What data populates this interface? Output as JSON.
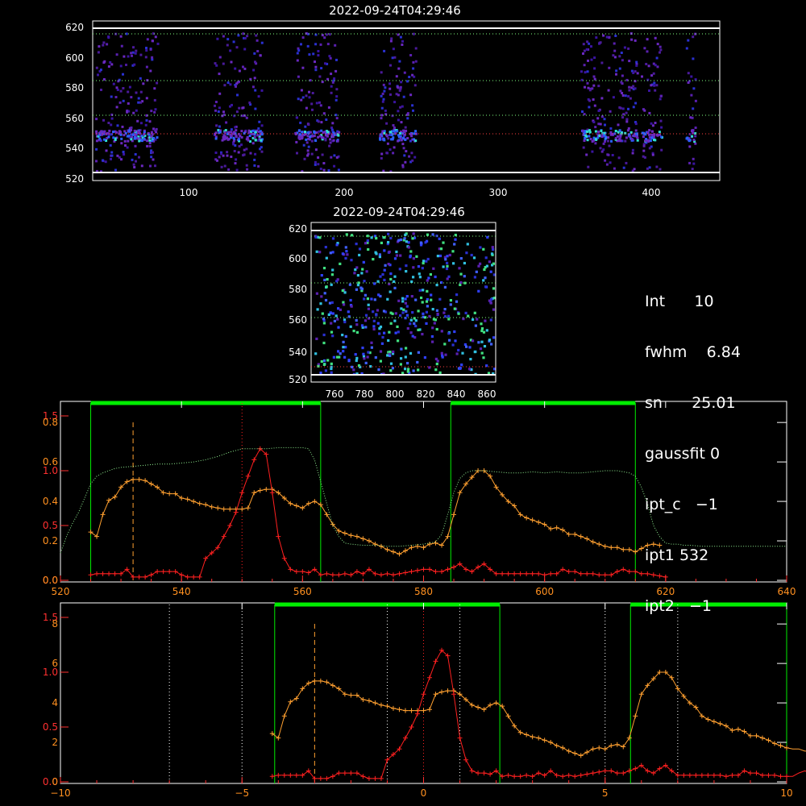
{
  "panels": {
    "top_image": {
      "title": "2022-09-24T04:29:46",
      "xticks": [
        "100",
        "200",
        "300",
        "400"
      ],
      "yticks": [
        "520",
        "540",
        "560",
        "580",
        "600",
        "620"
      ]
    },
    "zoom_image": {
      "title": "2022-09-24T04:29:46",
      "xticks": [
        "760",
        "780",
        "800",
        "820",
        "840",
        "860"
      ],
      "yticks": [
        "520",
        "540",
        "560",
        "580",
        "600",
        "620"
      ]
    }
  },
  "info": {
    "int_label": "Int",
    "int_value": "10",
    "fwhm_label": "fwhm",
    "fwhm_value": "6.84",
    "sn_label": "sn",
    "sn_value": "25.01",
    "gaussfit_label": "gaussfit",
    "gaussfit_value": "0",
    "ipt_c_label": "ipt_c",
    "ipt_c_value": "−1",
    "ipt1_label": "ipt1",
    "ipt1_value": "532",
    "ipt2_label": "ipt2",
    "ipt2_value": "−1"
  },
  "colors": {
    "background": "#000000",
    "axis": "#ffffff",
    "red_series": "#ff2020",
    "orange_series": "#ffa030",
    "green_band": "#00ee00",
    "green_dotted": "#90ee90",
    "red_axis": "#ff3030",
    "orange_axis": "#ff9020"
  },
  "chart_data": [
    {
      "type": "line",
      "x_range": [
        520,
        640
      ],
      "xticks": [
        "520",
        "540",
        "560",
        "580",
        "600",
        "620",
        "640"
      ],
      "y_left_red": [
        "0.0",
        "0.5",
        "1.0",
        "1.5"
      ],
      "y_left_orange": [
        "0.0",
        "0.2",
        "0.4",
        "0.6",
        "0.8"
      ],
      "green_bands": [
        [
          525,
          563
        ],
        [
          584.5,
          615
        ]
      ],
      "green_band_top": 1.5,
      "vlines": [
        {
          "x": 532,
          "style": "dashed",
          "color": "orange"
        },
        {
          "x": 550,
          "style": "dotted",
          "color": "red"
        }
      ],
      "series": [
        {
          "color": "orange",
          "x": [
            525,
            526,
            527,
            528,
            529,
            530,
            531,
            532,
            533,
            534,
            535,
            536,
            537,
            538,
            539,
            540,
            541,
            542,
            543,
            544,
            545,
            546,
            547,
            548,
            549,
            550,
            551,
            552,
            553,
            554,
            555,
            556,
            557,
            558,
            559,
            560,
            561,
            562,
            563,
            564,
            565,
            566,
            567,
            568,
            569,
            570,
            571,
            572,
            573,
            574,
            575,
            576,
            577,
            578,
            579,
            580,
            581,
            582,
            583,
            584,
            585,
            586,
            587,
            588,
            589,
            590,
            591,
            592,
            593,
            594,
            595,
            596,
            597,
            598,
            599,
            600,
            601,
            602,
            603,
            604,
            605,
            606,
            607,
            608,
            609,
            610,
            611,
            612,
            613,
            614,
            615,
            616,
            617,
            618,
            619
          ],
          "y": [
            0.44,
            0.4,
            0.6,
            0.73,
            0.76,
            0.85,
            0.9,
            0.92,
            0.92,
            0.91,
            0.88,
            0.85,
            0.8,
            0.79,
            0.79,
            0.75,
            0.74,
            0.72,
            0.7,
            0.69,
            0.67,
            0.66,
            0.65,
            0.65,
            0.65,
            0.65,
            0.66,
            0.8,
            0.82,
            0.83,
            0.83,
            0.8,
            0.75,
            0.7,
            0.68,
            0.66,
            0.7,
            0.72,
            0.69,
            0.6,
            0.51,
            0.45,
            0.43,
            0.41,
            0.4,
            0.38,
            0.36,
            0.33,
            0.31,
            0.28,
            0.26,
            0.24,
            0.27,
            0.3,
            0.31,
            0.3,
            0.33,
            0.34,
            0.32,
            0.4,
            0.6,
            0.8,
            0.88,
            0.94,
            1.0,
            1.0,
            0.95,
            0.85,
            0.78,
            0.72,
            0.68,
            0.6,
            0.57,
            0.55,
            0.53,
            0.51,
            0.47,
            0.48,
            0.46,
            0.42,
            0.42,
            0.4,
            0.38,
            0.35,
            0.33,
            0.31,
            0.3,
            0.3,
            0.28,
            0.28,
            0.26,
            0.29,
            0.32,
            0.33,
            0.32
          ]
        },
        {
          "color": "red",
          "x": [
            525,
            526,
            527,
            528,
            529,
            530,
            531,
            532,
            533,
            534,
            535,
            536,
            537,
            538,
            539,
            540,
            541,
            542,
            543,
            544,
            545,
            546,
            547,
            548,
            549,
            550,
            551,
            552,
            553,
            554,
            555,
            556,
            557,
            558,
            559,
            560,
            561,
            562,
            563,
            564,
            565,
            566,
            567,
            568,
            569,
            570,
            571,
            572,
            573,
            574,
            575,
            576,
            577,
            578,
            579,
            580,
            581,
            582,
            583,
            584,
            585,
            586,
            587,
            588,
            589,
            590,
            591,
            592,
            593,
            594,
            595,
            596,
            597,
            598,
            599,
            600,
            601,
            602,
            603,
            604,
            605,
            606,
            607,
            608,
            609,
            610,
            611,
            612,
            613,
            614,
            615,
            616,
            617,
            618,
            619,
            620
          ],
          "y": [
            0.05,
            0.06,
            0.06,
            0.06,
            0.06,
            0.06,
            0.1,
            0.03,
            0.03,
            0.03,
            0.05,
            0.08,
            0.08,
            0.08,
            0.08,
            0.05,
            0.03,
            0.03,
            0.03,
            0.2,
            0.25,
            0.3,
            0.4,
            0.5,
            0.62,
            0.8,
            0.95,
            1.1,
            1.2,
            1.15,
            0.8,
            0.4,
            0.2,
            0.1,
            0.08,
            0.08,
            0.07,
            0.1,
            0.05,
            0.06,
            0.05,
            0.05,
            0.06,
            0.05,
            0.08,
            0.06,
            0.1,
            0.06,
            0.05,
            0.06,
            0.05,
            0.06,
            0.07,
            0.08,
            0.09,
            0.1,
            0.1,
            0.08,
            0.08,
            0.1,
            0.12,
            0.15,
            0.1,
            0.08,
            0.12,
            0.15,
            0.1,
            0.06,
            0.06,
            0.06,
            0.06,
            0.06,
            0.06,
            0.06,
            0.06,
            0.05,
            0.06,
            0.06,
            0.1,
            0.08,
            0.08,
            0.06,
            0.06,
            0.06,
            0.05,
            0.05,
            0.05,
            0.08,
            0.1,
            0.08,
            0.08,
            0.06,
            0.06,
            0.05,
            0.04,
            0.03
          ]
        },
        {
          "color": "green-dotted",
          "x": [
            520,
            521,
            522,
            523,
            524,
            525,
            526,
            527,
            528,
            529,
            530,
            532,
            534,
            536,
            538,
            540,
            542,
            544,
            546,
            548,
            550,
            552,
            554,
            556,
            558,
            560,
            561,
            562,
            563,
            564,
            565,
            566,
            567,
            568,
            570,
            572,
            574,
            576,
            578,
            580,
            582,
            583,
            584,
            585,
            586,
            587,
            588,
            590,
            592,
            594,
            596,
            598,
            600,
            602,
            604,
            606,
            608,
            610,
            612,
            614,
            615,
            616,
            617,
            618,
            619,
            620,
            621,
            622,
            623,
            624,
            626,
            628,
            630,
            632,
            634,
            636,
            638,
            640
          ],
          "y": [
            0.25,
            0.4,
            0.52,
            0.62,
            0.75,
            0.88,
            0.95,
            0.98,
            1.0,
            1.02,
            1.03,
            1.04,
            1.05,
            1.06,
            1.06,
            1.07,
            1.08,
            1.1,
            1.13,
            1.17,
            1.2,
            1.2,
            1.2,
            1.21,
            1.21,
            1.21,
            1.2,
            1.1,
            0.9,
            0.7,
            0.5,
            0.4,
            0.34,
            0.33,
            0.32,
            0.32,
            0.31,
            0.31,
            0.32,
            0.33,
            0.35,
            0.42,
            0.6,
            0.8,
            0.93,
            0.98,
            1.0,
            1.0,
            0.99,
            0.98,
            0.98,
            0.99,
            0.98,
            0.99,
            0.98,
            0.98,
            0.99,
            1.0,
            1.0,
            0.98,
            0.95,
            0.85,
            0.7,
            0.5,
            0.4,
            0.34,
            0.33,
            0.33,
            0.32,
            0.32,
            0.31,
            0.31,
            0.31,
            0.31,
            0.31,
            0.31,
            0.31,
            0.31
          ]
        }
      ]
    },
    {
      "type": "line",
      "x_range": [
        -10,
        10
      ],
      "xticks": [
        "−10",
        "−5",
        "0",
        "5",
        "10"
      ],
      "y_left_red": [
        "0.0",
        "0.5",
        "1.0",
        "1.5"
      ],
      "y_left_orange": [
        "0",
        "2",
        "4",
        "6",
        "8"
      ],
      "green_bands": [
        [
          -4.1,
          2.1
        ],
        [
          5.7,
          10
        ]
      ],
      "vlines": [
        {
          "x": -3,
          "style": "dashed",
          "color": "orange"
        },
        {
          "x": 0,
          "style": "dotted",
          "color": "red"
        },
        {
          "x": -7,
          "style": "dotted",
          "color": "white"
        },
        {
          "x": -5,
          "style": "dotted",
          "color": "white"
        },
        {
          "x": -1,
          "style": "dotted",
          "color": "white"
        },
        {
          "x": 1,
          "style": "dotted",
          "color": "white"
        },
        {
          "x": 5,
          "style": "dotted",
          "color": "white"
        },
        {
          "x": 7,
          "style": "dotted",
          "color": "white"
        }
      ]
    }
  ]
}
